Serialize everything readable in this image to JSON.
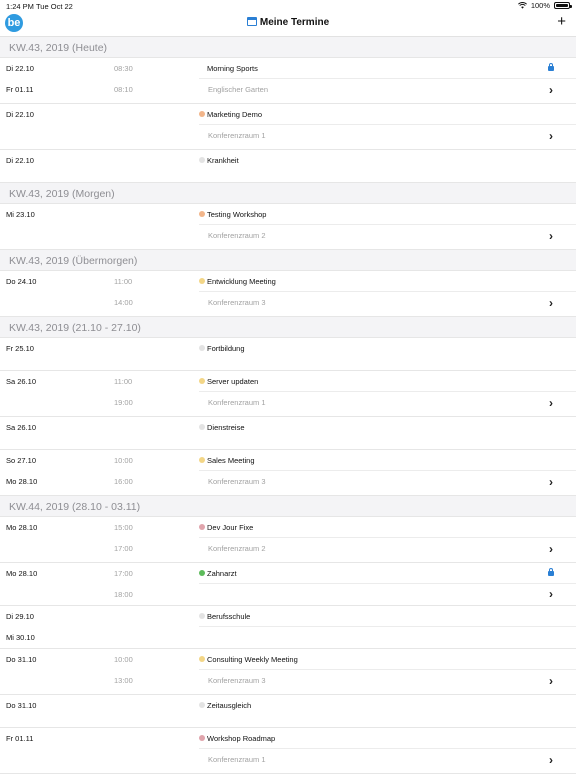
{
  "status_bar": {
    "time": "1:24 PM",
    "date": "Tue Oct 22",
    "battery": "100%"
  },
  "header": {
    "title": "Meine Termine",
    "add_label": "+",
    "logo_text": "be",
    "title_icon": "calendar-icon"
  },
  "colors": {
    "accent": "#2a7fd4",
    "logo": "#2f9be0",
    "dot_orange": "#f2b58a",
    "dot_yellow": "#f3d687",
    "dot_gray": "#d9d9d9",
    "dot_pink": "#e0a4ac",
    "dot_green": "#5dbb5b"
  },
  "sections": [
    {
      "title": "KW.43, 2019 (Heute)",
      "events": [
        {
          "start_date": "Di 22.10",
          "start_time": "08:30",
          "end_date": "Fr 01.11",
          "end_time": "08:10",
          "title": "Morning Sports",
          "location": "Englischer Garten",
          "dot": "",
          "lock": true,
          "chevron": true
        },
        {
          "start_date": "Di 22.10",
          "start_time": "",
          "end_date": "",
          "end_time": "",
          "title": "Marketing Demo",
          "location": "Konferenzraum 1",
          "dot": "#f2b58a",
          "lock": false,
          "chevron": true
        },
        {
          "start_date": "Di 22.10",
          "start_time": "",
          "end_date": "",
          "end_time": "",
          "title": "Krankheit",
          "location": "",
          "dot": "#e3e3e3",
          "lock": false,
          "chevron": false,
          "extra_space": true
        }
      ]
    },
    {
      "title": "KW.43, 2019 (Morgen)",
      "events": [
        {
          "start_date": "Mi 23.10",
          "start_time": "",
          "end_date": "",
          "end_time": "",
          "title": "Testing Workshop",
          "location": "Konferenzraum 2",
          "dot": "#f2b58a",
          "lock": false,
          "chevron": true
        }
      ]
    },
    {
      "title": "KW.43, 2019 (Übermorgen)",
      "events": [
        {
          "start_date": "Do 24.10",
          "start_time": "11:00",
          "end_date": "",
          "end_time": "14:00",
          "title": "Entwicklung Meeting",
          "location": "Konferenzraum 3",
          "dot": "#f3d687",
          "lock": false,
          "chevron": true
        }
      ]
    },
    {
      "title": "KW.43, 2019 (21.10 - 27.10)",
      "events": [
        {
          "start_date": "Fr 25.10",
          "start_time": "",
          "end_date": "",
          "end_time": "",
          "title": "Fortbildung",
          "location": "",
          "dot": "#e3e3e3",
          "lock": false,
          "chevron": false,
          "extra_space": true
        },
        {
          "start_date": "Sa 26.10",
          "start_time": "11:00",
          "end_date": "",
          "end_time": "19:00",
          "title": "Server updaten",
          "location": "Konferenzraum 1",
          "dot": "#f3d687",
          "lock": false,
          "chevron": true
        },
        {
          "start_date": "Sa 26.10",
          "start_time": "",
          "end_date": "",
          "end_time": "",
          "title": "Dienstreise",
          "location": "",
          "dot": "#e3e3e3",
          "lock": false,
          "chevron": false,
          "extra_space": true
        },
        {
          "start_date": "So 27.10",
          "start_time": "10:00",
          "end_date": "Mo 28.10",
          "end_time": "16:00",
          "title": "Sales Meeting",
          "location": "Konferenzraum 3",
          "dot": "#f3d687",
          "lock": false,
          "chevron": true
        }
      ]
    },
    {
      "title": "KW.44, 2019 (28.10 - 03.11)",
      "events": [
        {
          "start_date": "Mo 28.10",
          "start_time": "15:00",
          "end_date": "",
          "end_time": "17:00",
          "title": "Dev Jour Fixe",
          "location": "Konferenzraum 2",
          "dot": "#e0a4ac",
          "lock": false,
          "chevron": true
        },
        {
          "start_date": "Mo 28.10",
          "start_time": "17:00",
          "end_date": "",
          "end_time": "18:00",
          "title": "Zahnarzt",
          "location": "",
          "dot": "#5dbb5b",
          "lock": true,
          "chevron": true
        },
        {
          "start_date": "Di 29.10",
          "start_time": "",
          "end_date": "Mi 30.10",
          "end_time": "",
          "title": "Berufsschule",
          "location": "",
          "dot": "#e3e3e3",
          "lock": false,
          "chevron": false
        },
        {
          "start_date": "Do 31.10",
          "start_time": "10:00",
          "end_date": "",
          "end_time": "13:00",
          "title": "Consulting Weekly Meeting",
          "location": "Konferenzraum 3",
          "dot": "#f3d687",
          "lock": false,
          "chevron": true
        },
        {
          "start_date": "Do 31.10",
          "start_time": "",
          "end_date": "",
          "end_time": "",
          "title": "Zeitausgleich",
          "location": "",
          "dot": "#e3e3e3",
          "lock": false,
          "chevron": false,
          "extra_space": true
        },
        {
          "start_date": "Fr 01.11",
          "start_time": "",
          "end_date": "",
          "end_time": "",
          "title": "Workshop Roadmap",
          "location": "Konferenzraum 1",
          "dot": "#e0a4ac",
          "lock": false,
          "chevron": true
        }
      ]
    }
  ]
}
